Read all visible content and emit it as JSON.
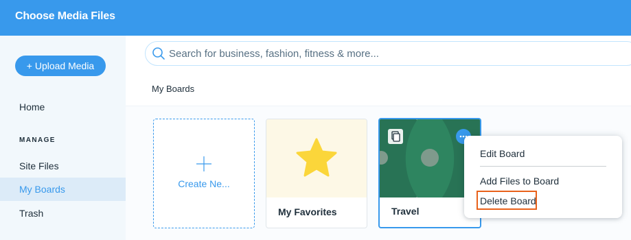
{
  "header": {
    "title": "Choose Media Files"
  },
  "sidebar": {
    "upload_label": "+ Upload Media",
    "home_label": "Home",
    "section_label": "MANAGE",
    "items": [
      {
        "label": "Site Files",
        "active": false
      },
      {
        "label": "My Boards",
        "active": true
      },
      {
        "label": "Trash",
        "active": false
      }
    ]
  },
  "search": {
    "placeholder": "Search for business, fashion, fitness & more...",
    "value": ""
  },
  "main": {
    "section_title": "My Boards",
    "create_label": "Create Ne...",
    "boards": [
      {
        "label": "My Favorites",
        "icon": "star-icon"
      },
      {
        "label": "Travel",
        "icon": "copy-icon"
      }
    ]
  },
  "context_menu": {
    "items": [
      "Edit Board",
      "Add Files to Board",
      "Delete Board"
    ],
    "highlighted": "Delete Board"
  },
  "colors": {
    "accent": "#3899ec",
    "sidebar_bg": "#f2f8fc",
    "highlight": "#e8611a",
    "star": "#fbd63a",
    "travel_green": "#1f6f4f"
  }
}
